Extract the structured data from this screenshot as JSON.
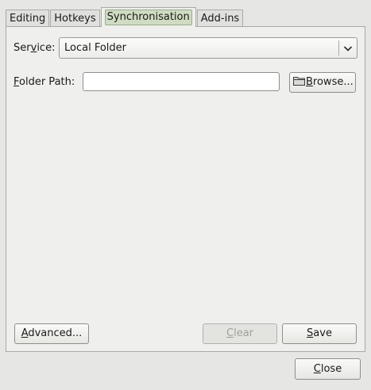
{
  "tabs": [
    {
      "label": "Editing",
      "active": false
    },
    {
      "label": "Hotkeys",
      "active": false
    },
    {
      "label": "Synchronisation",
      "active": true
    },
    {
      "label": "Add-ins",
      "active": false
    }
  ],
  "service": {
    "label_pre": "Ser",
    "label_ul": "v",
    "label_post": "ice:",
    "value": "Local Folder",
    "icon": "chevron-down-icon"
  },
  "folder_path": {
    "label_ul": "F",
    "label_post": "older Path:",
    "value": "",
    "placeholder": ""
  },
  "browse": {
    "icon": "folder-icon",
    "label_ul": "B",
    "label_post": "rowse..."
  },
  "buttons": {
    "advanced_ul": "A",
    "advanced_post": "dvanced...",
    "clear_ul": "C",
    "clear_post": "lear",
    "clear_enabled": false,
    "save_ul": "S",
    "save_post": "ave",
    "close_ul": "C",
    "close_post": "lose"
  },
  "colors": {
    "active_tab_highlight": "#cfdcc1",
    "window_bg": "#e6e6e4",
    "panel_bg": "#efefee"
  }
}
